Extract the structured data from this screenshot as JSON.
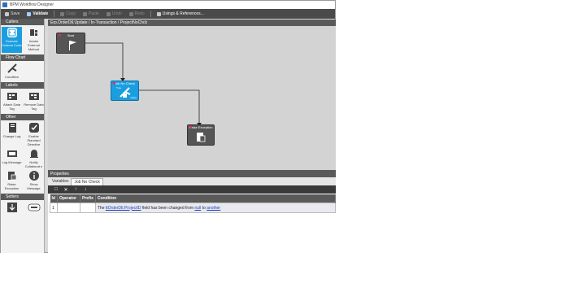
{
  "window": {
    "title": "BPM Workflow Designer"
  },
  "toolbar": {
    "save": "Save",
    "validate": "Validate",
    "copy": "Copy",
    "paste": "Paste",
    "undo": "Undo",
    "redo": "Redo",
    "usings": "Usings & References..."
  },
  "palette": {
    "sections": [
      {
        "title": "Callers",
        "items": [
          {
            "label": "Execute Custom Code",
            "icon": "code-icon",
            "selected": true
          },
          {
            "label": "Invoke External Method",
            "icon": "invoke-method-icon"
          }
        ]
      },
      {
        "title": "Flow Chart",
        "items": [
          {
            "label": "Condition",
            "icon": "condition-icon"
          }
        ]
      },
      {
        "title": "Labels",
        "items": [
          {
            "label": "Attach Data Tag",
            "icon": "attach-tag-icon"
          },
          {
            "label": "Remove Data Tag",
            "icon": "remove-tag-icon"
          }
        ]
      },
      {
        "title": "Other",
        "items": [
          {
            "label": "Change Log",
            "icon": "change-log-icon"
          },
          {
            "label": "Enable Standard Directive",
            "icon": "standard-directive-icon"
          },
          {
            "label": "Log Message",
            "icon": "log-message-icon"
          },
          {
            "label": "Notify Collaborat e",
            "icon": "bell-icon"
          },
          {
            "label": "Raise Exception",
            "icon": "raise-exception-icon"
          },
          {
            "label": "Show Message",
            "icon": "info-icon"
          }
        ]
      },
      {
        "title": "Setters",
        "items": [
          {
            "label": "",
            "icon": "setter-icon"
          },
          {
            "label": "",
            "icon": "abc-field-icon"
          }
        ]
      }
    ]
  },
  "canvas": {
    "breadcrumb": "Erp.OrderDtl.Update / In-Transaction / ProjectNoChck",
    "nodes": {
      "start": {
        "title": "Start"
      },
      "job_no_check": {
        "title": "Job No Check",
        "true_label": "True",
        "false_label": "False"
      },
      "raise_exception": {
        "title": "Raise Exception"
      }
    }
  },
  "properties": {
    "title": "Properties",
    "tabs": [
      "Variables",
      "Job No Check"
    ],
    "active_tab": "Job No Check",
    "columns": [
      "Id",
      "Operator",
      "Prefix",
      "Condition"
    ],
    "rows": [
      {
        "id": "1",
        "operator": "",
        "prefix": "",
        "condition_prefix": "The ",
        "condition_field": "ttOrderDtl.ProjectID",
        "condition_mid": " field has been changed from ",
        "condition_from": "null",
        "condition_to_word": " to ",
        "condition_to": "another"
      }
    ]
  },
  "colors": {
    "accent": "#1b9ee0",
    "toolbar_bg": "#4a4a4a",
    "header_bg": "#5a5a5a",
    "flag_red": "#e0246e"
  }
}
